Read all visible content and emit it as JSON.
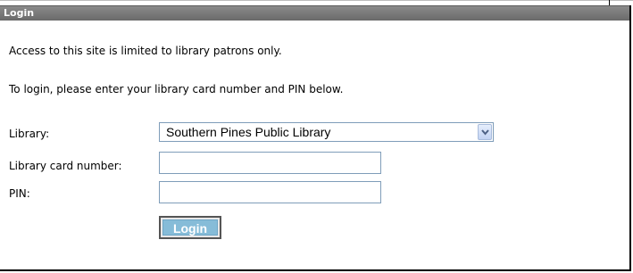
{
  "panel": {
    "title": "Login"
  },
  "messages": {
    "access_notice": "Access to this site is limited to library patrons only.",
    "instructions": "To login, please enter your library card number and PIN below."
  },
  "form": {
    "library_label": "Library:",
    "library_selected": "Southern Pines Public Library",
    "card_label": "Library card number:",
    "card_value": "",
    "pin_label": "PIN:",
    "pin_value": "",
    "login_button": "Login"
  },
  "icons": {
    "dropdown": "chevron-down-icon"
  },
  "colors": {
    "header_bg": "#7a7a7a",
    "button_bg": "#86bcd8",
    "input_border": "#7f9db9"
  }
}
